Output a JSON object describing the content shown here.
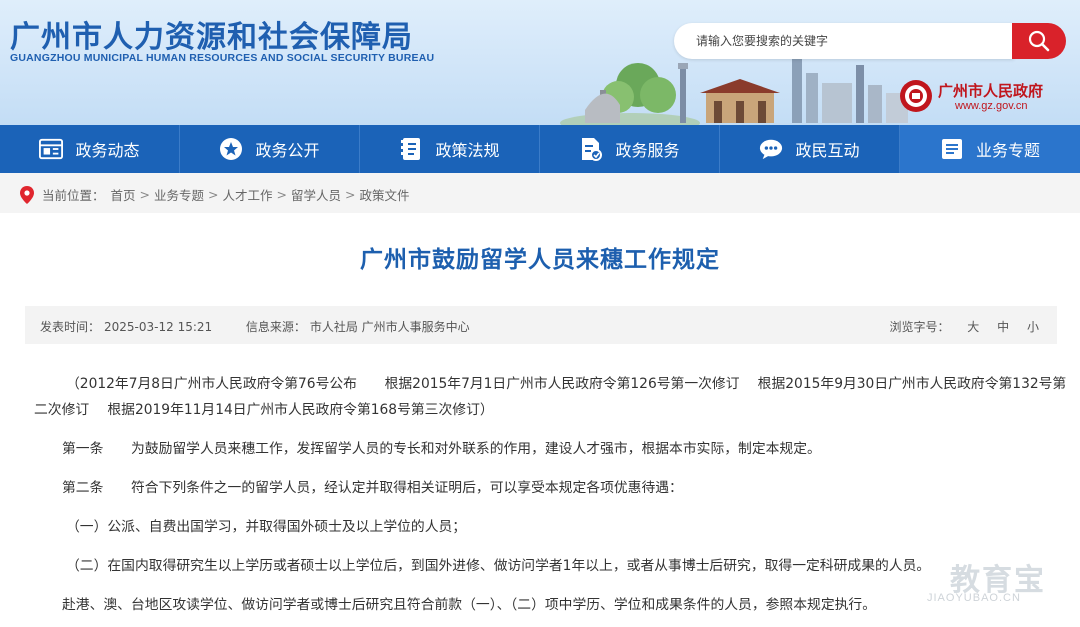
{
  "header": {
    "title_cn": "广州市人力资源和社会保障局",
    "title_en": "GUANGZHOU MUNICIPAL HUMAN RESOURCES AND SOCIAL SECURITY BUREAU",
    "search_placeholder": "请输入您要搜索的关键字",
    "gov_name": "广州市人民政府",
    "gov_url": "www.gz.gov.cn"
  },
  "nav": {
    "items": [
      {
        "label": "政务动态",
        "icon": "news-icon"
      },
      {
        "label": "政务公开",
        "icon": "star-badge-icon"
      },
      {
        "label": "政策法规",
        "icon": "book-icon"
      },
      {
        "label": "政务服务",
        "icon": "service-doc-icon"
      },
      {
        "label": "政民互动",
        "icon": "chat-bubble-icon"
      },
      {
        "label": "业务专题",
        "icon": "list-doc-icon"
      }
    ],
    "active_index": 5
  },
  "breadcrumb": {
    "prefix": "当前位置：",
    "items": [
      "首页",
      "业务专题",
      "人才工作",
      "留学人员",
      "政策文件"
    ],
    "separator": ">"
  },
  "article": {
    "title": "广州市鼓励留学人员来穗工作规定",
    "publish_label": "发表时间：",
    "publish_time": "2025-03-12 15:21",
    "source_label": "信息来源：",
    "source": "市人社局 广州市人事服务中心",
    "font_size_label": "浏览字号：",
    "font_sizes": [
      "大",
      "中",
      "小"
    ],
    "paragraphs": {
      "p1_line1": "（2012年7月8日广州市人民政府令第76号公布　　根据2015年7月1日广州市人民政府令第126号第一次修订　 根据2015年9月30日广州市人民政府令第132号第",
      "p1_line2": "二次修订　 根据2019年11月14日广州市人民政府令第168号第三次修订）",
      "p2": "第一条　　为鼓励留学人员来穗工作，发挥留学人员的专长和对外联系的作用，建设人才强市，根据本市实际，制定本规定。",
      "p3": "第二条　　符合下列条件之一的留学人员，经认定并取得相关证明后，可以享受本规定各项优惠待遇：",
      "p4": "（一）公派、自费出国学习，并取得国外硕士及以上学位的人员；",
      "p5": "（二）在国内取得研究生以上学历或者硕士以上学位后，到国外进修、做访问学者1年以上，或者从事博士后研究，取得一定科研成果的人员。",
      "p6": "赴港、澳、台地区攻读学位、做访问学者或博士后研究且符合前款（一）、（二）项中学历、学位和成果条件的人员，参照本规定执行。"
    }
  },
  "watermark": {
    "cn": "教育宝",
    "en": "JIAOYUBAO.CN"
  },
  "colors": {
    "nav_blue": "#1b63b8",
    "title_blue": "#1d5fae",
    "search_red": "#d9222a",
    "gov_red": "#c0161d"
  }
}
